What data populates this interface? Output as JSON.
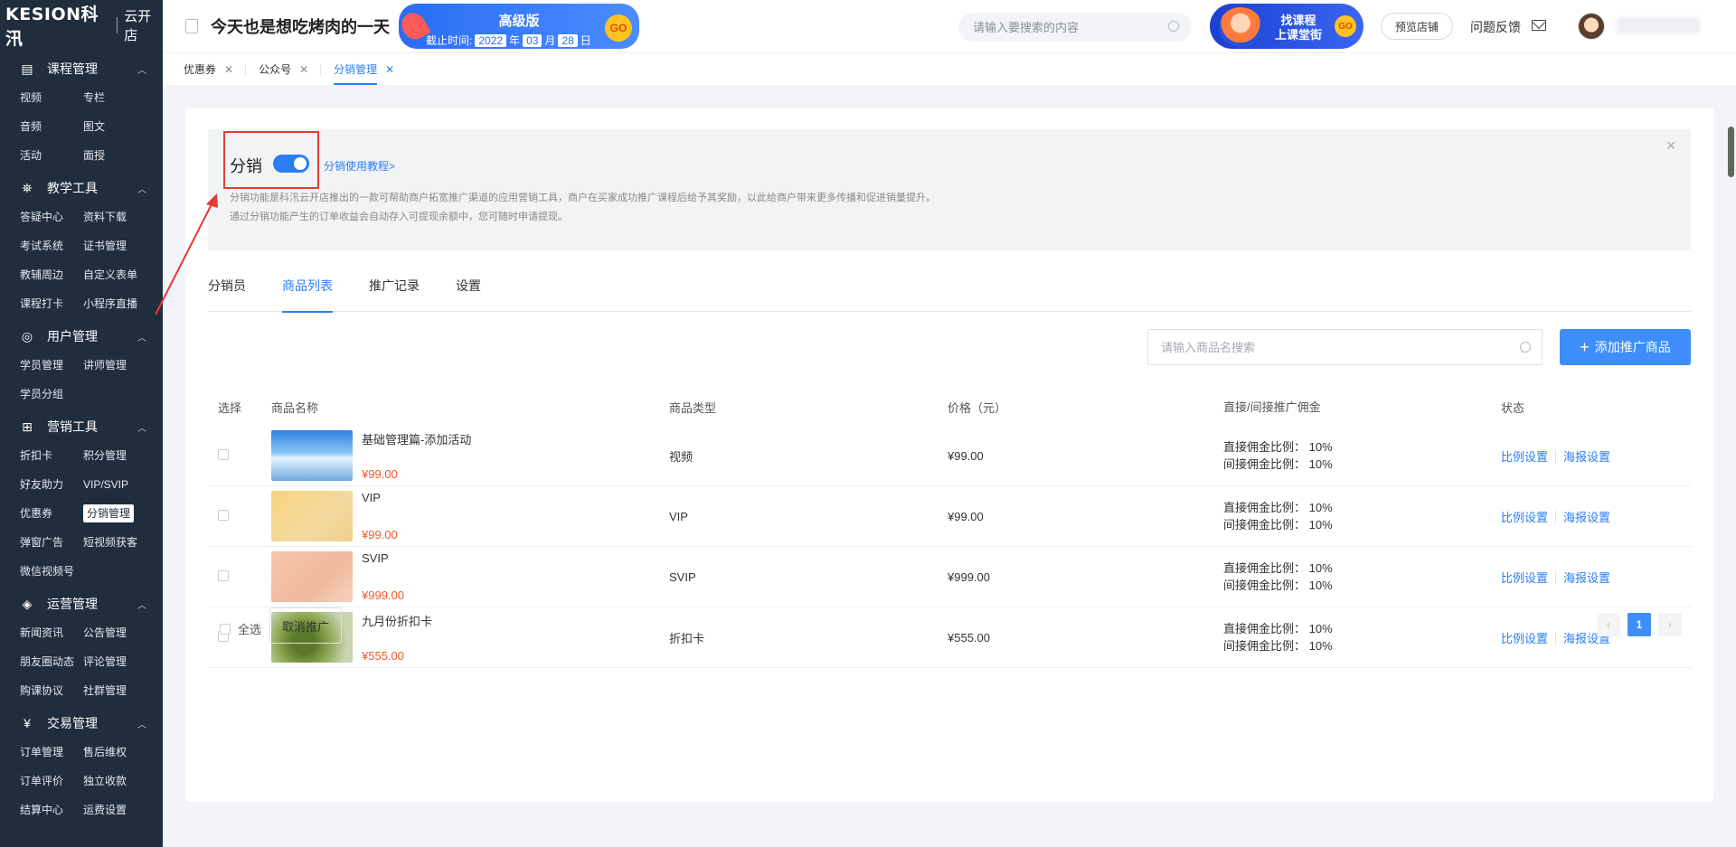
{
  "sidebar": {
    "logo": {
      "brand": "KESION科汛",
      "store": "云开店"
    },
    "groups": [
      {
        "title": "课程管理",
        "icon": "course-icon",
        "items": [
          "视频",
          "专栏",
          "音频",
          "图文",
          "活动",
          "面授"
        ]
      },
      {
        "title": "教学工具",
        "icon": "teaching-tool-icon",
        "items": [
          "答疑中心",
          "资料下载",
          "考试系统",
          "证书管理",
          "教辅周边",
          "自定义表单",
          "课程打卡",
          "小程序直播"
        ]
      },
      {
        "title": "用户管理",
        "icon": "user-icon",
        "items": [
          "学员管理",
          "讲师管理",
          "学员分组"
        ]
      },
      {
        "title": "营销工具",
        "icon": "gift-icon",
        "items": [
          "折扣卡",
          "积分管理",
          "好友助力",
          "VIP/SVIP",
          "优惠券",
          "分销管理",
          "弹窗广告",
          "短视频获客",
          "微信视频号"
        ]
      },
      {
        "title": "运营管理",
        "icon": "layers-icon",
        "items": [
          "新闻资讯",
          "公告管理",
          "朋友圈动态",
          "评论管理",
          "购课协议",
          "社群管理"
        ]
      },
      {
        "title": "交易管理",
        "icon": "yuan-icon",
        "items": [
          "订单管理",
          "售后维权",
          "订单评价",
          "独立收款",
          "结算中心",
          "运费设置"
        ]
      }
    ],
    "active_item": "分销管理"
  },
  "topbar": {
    "store_name": "今天也是想吃烤肉的一天",
    "badge": {
      "title": "高级版",
      "deadline_label": "截止时间:",
      "year": "2022",
      "year_unit": "年",
      "month": "03",
      "month_unit": "月",
      "day": "28",
      "day_unit": "日",
      "go": "GO"
    },
    "search_placeholder": "请输入要搜索的内容",
    "promo": {
      "line1": "找课程",
      "line2": "上课堂街",
      "go": "GO"
    },
    "preview_store": "预览店铺",
    "feedback": "问题反馈"
  },
  "page_tabs": [
    {
      "label": "优惠券",
      "active": false
    },
    {
      "label": "公众号",
      "active": false
    },
    {
      "label": "分销管理",
      "active": true
    }
  ],
  "intro": {
    "title": "分销",
    "toggle_on": true,
    "tutorial_link": "分销使用教程>",
    "desc_line1": "分销功能是科汛云开店推出的一款可帮助商户拓宽推广渠道的应用营销工具，商户在买家成功推广课程后给予其奖励，以此给商户带来更多传播和促进销量提升。",
    "desc_line2": "通过分销功能产生的订单收益会自动存入可提现余额中，您可随时申请提现。"
  },
  "sub_tabs": [
    "分销员",
    "商品列表",
    "推广记录",
    "设置"
  ],
  "active_sub_tab": 1,
  "goods_search_placeholder": "请输入商品名搜索",
  "add_button": "添加推广商品",
  "table": {
    "headers": [
      "选择",
      "商品名称",
      "商品类型",
      "价格（元）",
      "直接/间接推广佣金",
      "状态"
    ],
    "rows": [
      {
        "name": "基础管理篇-添加活动",
        "price_tag": "¥99.00",
        "type": "视频",
        "price": "¥99.00",
        "direct": "直接佣金比例： 10%",
        "indirect": "间接佣金比例： 10%",
        "thumb": "t1"
      },
      {
        "name": "VIP",
        "price_tag": "¥99.00",
        "type": "VIP",
        "price": "¥99.00",
        "direct": "直接佣金比例： 10%",
        "indirect": "间接佣金比例： 10%",
        "thumb": "t2"
      },
      {
        "name": "SVIP",
        "price_tag": "¥999.00",
        "type": "SVIP",
        "price": "¥999.00",
        "direct": "直接佣金比例： 10%",
        "indirect": "间接佣金比例： 10%",
        "thumb": "t3"
      },
      {
        "name": "九月份折扣卡",
        "price_tag": "¥555.00",
        "type": "折扣卡",
        "price": "¥555.00",
        "direct": "直接佣金比例： 10%",
        "indirect": "间接佣金比例： 10%",
        "thumb": "t4"
      }
    ],
    "ratio_link": "比例设置",
    "poster_link": "海报设置"
  },
  "footer": {
    "select_all": "全选",
    "cancel_button": "取消推广",
    "current_page": "1",
    "prev": "‹",
    "next": "›"
  },
  "colors": {
    "accent": "#2a7ef5",
    "price": "#f2572b",
    "sidebar_bg": "#1f2d3d",
    "annotation": "#e53935"
  }
}
